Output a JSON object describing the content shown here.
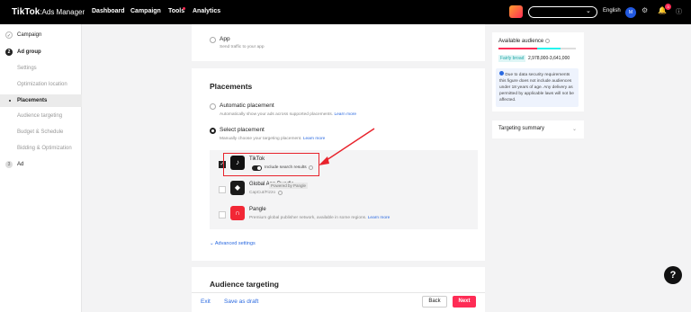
{
  "topbar": {
    "logo_main": "TikTok",
    "logo_sep": ":",
    "logo_sub": "Ads Manager",
    "nav": [
      "Dashboard",
      "Campaign",
      "Tools",
      "Analytics"
    ],
    "lang": "English",
    "avatar_initial": "M",
    "bell_count": "3"
  },
  "sidebar": {
    "campaign": "Campaign",
    "adgroup_num": "2",
    "adgroup": "Ad group",
    "settings": "Settings",
    "optimization_location": "Optimization location",
    "placements": "Placements",
    "audience_targeting": "Audience targeting",
    "budget_schedule": "Budget & Schedule",
    "bidding_optimization": "Bidding & Optimization",
    "ad_num": "3",
    "ad": "Ad"
  },
  "app_option": {
    "label": "App",
    "desc": "Send traffic to your app"
  },
  "placements": {
    "title": "Placements",
    "automatic_label": "Automatic placement",
    "automatic_desc": "Automatically show your ads across supported placements.",
    "learn_more": "Learn more",
    "select_label": "Select placement",
    "select_desc": "Manually choose your targeting placement.",
    "tiktok_name": "TikTok",
    "tiktok_toggle_label": "Include search results",
    "global_name": "Global App Bundle",
    "global_tag": "Powered by Pangle",
    "global_desc": "CapCut/Fizzo",
    "pangle_name": "Pangle",
    "pangle_desc": "Premium global publisher network, available in some regions.",
    "advanced": "Advanced settings"
  },
  "audience_section": {
    "title": "Audience targeting"
  },
  "right_panel": {
    "available_audience": "Available audience",
    "fairly_broad": "Fairly broad",
    "range": "2,978,000-3,641,000",
    "note": "Due to data security requirements this figure does not include audiences under 18 years of age. Any delivery as permitted by applicable laws will not be affected.",
    "targeting_summary": "Targeting summary"
  },
  "footer": {
    "exit": "Exit",
    "save_draft": "Save as draft",
    "back": "Back",
    "next": "Next"
  },
  "colors": {
    "accent": "#fe2c55",
    "link": "#2a69e0",
    "highlight": "#e8232c"
  }
}
